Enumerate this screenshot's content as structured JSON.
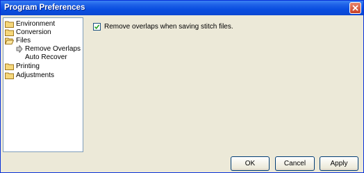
{
  "window": {
    "title": "Program Preferences"
  },
  "tree": {
    "items": [
      {
        "label": "Environment",
        "icon": "folder-icon"
      },
      {
        "label": "Conversion",
        "icon": "folder-icon"
      },
      {
        "label": "Files",
        "icon": "folder-icon",
        "expanded": true
      },
      {
        "label": "Remove Overlaps",
        "icon": "arrow-icon",
        "selected": true
      },
      {
        "label": "Auto Recover"
      },
      {
        "label": "Printing",
        "icon": "folder-icon"
      },
      {
        "label": "Adjustments",
        "icon": "folder-icon"
      }
    ]
  },
  "options": {
    "remove_overlaps_label": "Remove overlaps when saving stitch files.",
    "remove_overlaps_checked": true
  },
  "buttons": {
    "ok": "OK",
    "cancel": "Cancel",
    "apply": "Apply"
  },
  "colors": {
    "title_bar": "#0a4ee0",
    "dialog_bg": "#ece9d8",
    "folder": "#f5d77a"
  }
}
